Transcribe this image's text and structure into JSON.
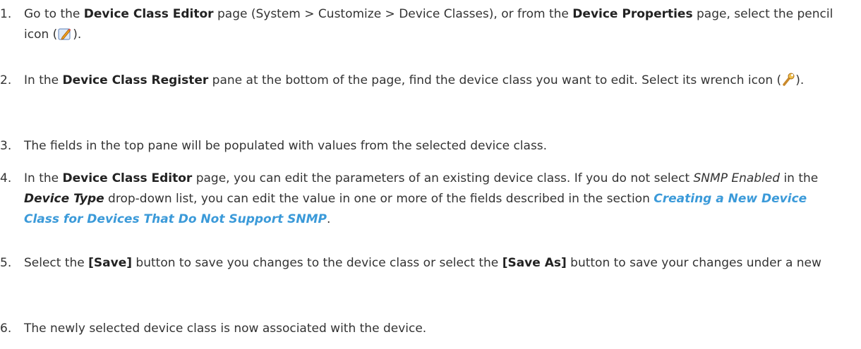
{
  "steps": [
    {
      "num": "1.",
      "a": "Go to the ",
      "b1": "Device Class Editor",
      "c": " page (System > Customize > Device Classes), or from the ",
      "b2": "Device Properties",
      "d": " page, select the pencil icon (",
      "e": ")."
    },
    {
      "num": "2.",
      "a": "In the ",
      "b1": "Device Class Register",
      "c": " pane at the bottom of the page, find the device class you want to edit. Select its wrench icon (",
      "e": ")."
    },
    {
      "num": "3.",
      "a": "The fields in the top pane will be populated with values from the selected device class."
    },
    {
      "num": "4.",
      "a": "In the ",
      "b1": "Device Class Editor",
      "c": " page, you can edit the parameters of an existing device class. If you do not select ",
      "i1": "SNMP Enabled",
      "d": " in the ",
      "bi1": "Device Type",
      "e": " drop-down list, you can edit the value in one or more of the fields described in the section ",
      "link": "Creating a New Device Class for Devices That Do Not Support SNMP",
      "f": "."
    },
    {
      "num": "5.",
      "a": "Select the ",
      "b1": "[Save]",
      "c": " button to save you changes to the device class or select the ",
      "b2": "[Save As]",
      "d": " button to save your changes under a new"
    },
    {
      "num": "6.",
      "a": "The newly selected device class is now associated with the device."
    }
  ]
}
